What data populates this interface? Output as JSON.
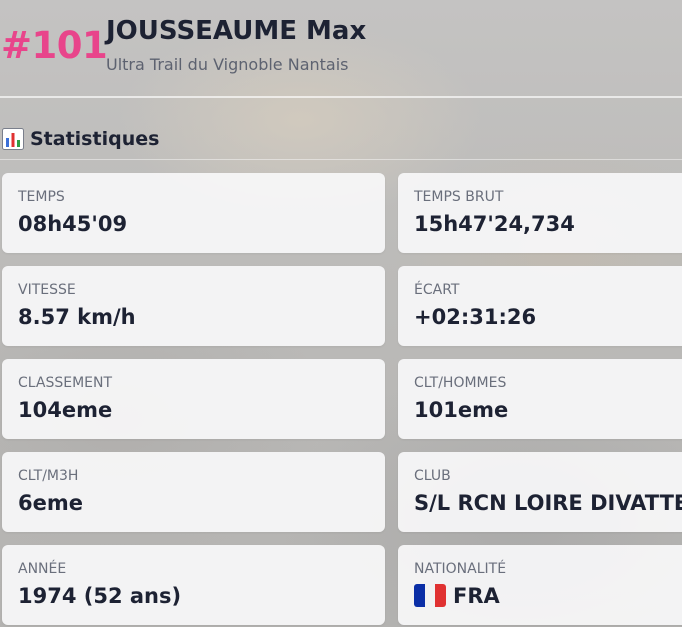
{
  "header": {
    "bib": "#101",
    "name": "JOUSSEAUME Max",
    "race": "Ultra Trail du Vignoble Nantais"
  },
  "section": {
    "icon": "bar-chart-icon",
    "title": "Statistiques"
  },
  "stats": [
    {
      "label": "TEMPS",
      "value": "08h45'09"
    },
    {
      "label": "TEMPS BRUT",
      "value": "15h47'24,734"
    },
    {
      "label": "VITESSE",
      "value": "8.57 km/h"
    },
    {
      "label": "ÉCART",
      "value": "+02:31:26"
    },
    {
      "label": "CLASSEMENT",
      "value": "104eme"
    },
    {
      "label": "CLT/HOMMES",
      "value": "101eme"
    },
    {
      "label": "CLT/M3H",
      "value": "6eme"
    },
    {
      "label": "CLUB",
      "value": "S/L RCN LOIRE DIVATTE"
    },
    {
      "label": "ANNÉE",
      "value": "1974 (52 ans)"
    },
    {
      "label": "NATIONALITÉ",
      "value": "FRA",
      "icon": "france-flag-icon"
    }
  ],
  "colors": {
    "bib": "#e8458b",
    "text": "#1d2233",
    "muted": "#6a6f7c"
  }
}
